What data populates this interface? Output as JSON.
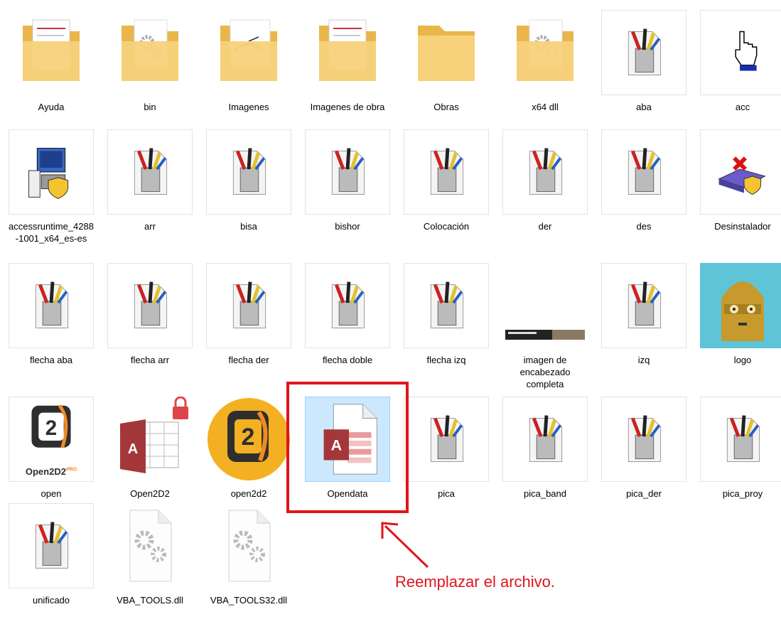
{
  "files": [
    {
      "label": "Ayuda",
      "icon": "folder-with-documents-icon"
    },
    {
      "label": "bin",
      "icon": "folder-with-gears-icon"
    },
    {
      "label": "Imagenes",
      "icon": "folder-with-drawing-icon"
    },
    {
      "label": "Imagenes de obra",
      "icon": "folder-with-documents-icon"
    },
    {
      "label": "Obras",
      "icon": "folder-icon"
    },
    {
      "label": "x64 dll",
      "icon": "folder-with-gears-icon"
    },
    {
      "label": "aba",
      "icon": "cursor-file-icon"
    },
    {
      "label": "acc",
      "icon": "hand-pointer-cursor-icon"
    },
    {
      "label": "accessruntime_4288-1001_x64_es-es",
      "icon": "installer-icon"
    },
    {
      "label": "arr",
      "icon": "cursor-file-icon"
    },
    {
      "label": "bisa",
      "icon": "cursor-file-icon"
    },
    {
      "label": "bishor",
      "icon": "cursor-file-icon"
    },
    {
      "label": "Colocación",
      "icon": "cursor-file-icon"
    },
    {
      "label": "der",
      "icon": "cursor-file-icon"
    },
    {
      "label": "des",
      "icon": "cursor-file-icon"
    },
    {
      "label": "Desinstalador",
      "icon": "uninstaller-icon"
    },
    {
      "label": "flecha aba",
      "icon": "cursor-file-icon"
    },
    {
      "label": "flecha arr",
      "icon": "cursor-file-icon"
    },
    {
      "label": "flecha der",
      "icon": "cursor-file-icon"
    },
    {
      "label": "flecha doble",
      "icon": "cursor-file-icon"
    },
    {
      "label": "flecha izq",
      "icon": "cursor-file-icon"
    },
    {
      "label": "imagen de encabezado completa",
      "icon": "banner-image-thumbnail-icon"
    },
    {
      "label": "izq",
      "icon": "cursor-file-icon"
    },
    {
      "label": "logo",
      "icon": "robot-face-image-icon"
    },
    {
      "label": "open",
      "icon": "open2d2-logo-icon",
      "badge": "Open2D2",
      "badge_sup": "PRO"
    },
    {
      "label": "Open2D2",
      "icon": "access-locked-database-icon"
    },
    {
      "label": "open2d2",
      "icon": "open2d2-round-logo-icon"
    },
    {
      "label": "Opendata",
      "icon": "access-database-file-icon",
      "selected": true
    },
    {
      "label": "pica",
      "icon": "cursor-file-icon"
    },
    {
      "label": "pica_band",
      "icon": "cursor-file-icon"
    },
    {
      "label": "pica_der",
      "icon": "cursor-file-icon"
    },
    {
      "label": "pica_proy",
      "icon": "cursor-file-icon"
    },
    {
      "label": "unificado",
      "icon": "cursor-file-icon"
    },
    {
      "label": "VBA_TOOLS.dll",
      "icon": "dll-file-icon"
    },
    {
      "label": "VBA_TOOLS32.dll",
      "icon": "dll-file-icon"
    }
  ],
  "callout": {
    "text": "Reemplazar el archivo.",
    "color": "#e0141c"
  },
  "colors": {
    "selection_bg": "#cce8ff",
    "selection_border": "#99d1ff",
    "folder": "#f3c55a",
    "access_red": "#a4373a"
  }
}
